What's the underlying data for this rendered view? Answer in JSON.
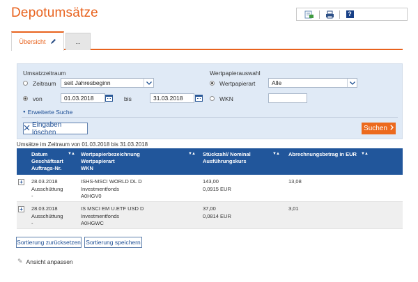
{
  "page": {
    "title": "Depotumsätze"
  },
  "toolbar": {
    "icons": [
      "export-icon",
      "print-icon",
      "help-icon"
    ],
    "help_label": "?"
  },
  "tabs": [
    {
      "label": "Übersicht",
      "active": true
    },
    {
      "label": "...",
      "active": false
    }
  ],
  "filter": {
    "umsatzzeitraum_label": "Umsatzzeitraum",
    "zeitraum_label": "Zeitraum",
    "zeitraum_value": "seit Jahresbeginn",
    "von_label": "von",
    "von_value": "01.03.2018",
    "bis_label": "bis",
    "bis_value": "31.03.2018",
    "erweiterte_suche": "Erweiterte Suche",
    "wertpapierauswahl_label": "Wertpapierauswahl",
    "wertpapierart_label": "Wertpapierart",
    "wertpapierart_value": "Alle",
    "wkn_label": "WKN",
    "wkn_value": "",
    "clear_label": "Eingaben löschen",
    "search_label": "Suchen"
  },
  "zeitraum_text": "Umsätze im Zeitraum von 01.03.2018 bis 31.03.2018",
  "table": {
    "headers": [
      [
        "Datum",
        "Geschäftsart",
        "Auftrags-Nr."
      ],
      [
        "Wertpapierbezeichnung",
        "Wertpapierart",
        "WKN"
      ],
      [
        "Stückzahl/ Nominal",
        "Ausführungskurs"
      ],
      [
        "Abrechnungsbetrag in EUR"
      ]
    ],
    "rows": [
      {
        "datum": "28.03.2018",
        "geschaeftsart": "Ausschüttung",
        "auftrag": "-",
        "bezeichnung": "ISHS-MSCI WORLD DL D",
        "art": "Investmentfonds",
        "wkn": "A0HGV0",
        "stueck": "143,00",
        "kurs": "0,0915 EUR",
        "betrag": "13,08"
      },
      {
        "datum": "28.03.2018",
        "geschaeftsart": "Ausschüttung",
        "auftrag": "-",
        "bezeichnung": "IS MSCI EM U.ETF USD D",
        "art": "Investmentfonds",
        "wkn": "A0HGWC",
        "stueck": "37,00",
        "kurs": "0,0814 EUR",
        "betrag": "3,01"
      }
    ]
  },
  "actions": {
    "reset_sort": "Sortierung zurücksetzen",
    "save_sort": "Sortierung speichern",
    "adjust_view": "Ansicht anpassen"
  },
  "colors": {
    "accent": "#e8621d",
    "header_blue": "#21569b",
    "panel": "#e0eaf6"
  }
}
